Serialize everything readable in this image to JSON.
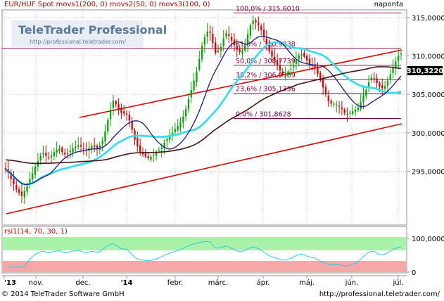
{
  "header": {
    "symbol": "EUR/HUF Spot",
    "indicators": [
      "movs1(200, 0)",
      "movs2(50, 0)",
      "movs3(100, 0)"
    ],
    "period": "naponta"
  },
  "watermark": {
    "brand": "TeleTrader Professional",
    "url": "http://professional.teletrader.com/"
  },
  "footer": {
    "copyright": "© 2014 TeleTrader Software GmbH",
    "url": "http://professional.teletrader.com/"
  },
  "colors": {
    "price_up": "#00aa00",
    "price_down": "#dd0000",
    "ma200": "#4a1010",
    "ma50": "#1a1a80",
    "ma100": "#33e0f0",
    "trend": "#dd0000",
    "rsi_line": "#22ccee"
  },
  "chart_data": [
    {
      "type": "candlestick",
      "title": "EUR/HUF Spot",
      "ylim": [
        288,
        316
      ],
      "y_ticks": [
        295,
        300,
        305,
        310,
        315
      ],
      "y_tick_labels": [
        "295,0000",
        "300,0000",
        "305,0000",
        "310,0000",
        "315,0000"
      ],
      "x_labels": [
        "'13",
        "nov.",
        "dec.",
        "'14",
        "febr.",
        "márc.",
        "ápr.",
        "máj.",
        "jún.",
        "júl."
      ],
      "last_price": "310,3220",
      "fibonacci": [
        {
          "label": "100,0% / 315,6010",
          "value": 315.601
        },
        {
          "label": "61,8% / 310,9838",
          "value": 310.9838
        },
        {
          "label": "50,0% / 308,7739",
          "value": 308.7739
        },
        {
          "label": "38,2% / 306,9389",
          "value": 306.9389
        },
        {
          "label": "23,6% / 305,1356",
          "value": 305.1356
        },
        {
          "label": "0,0% / 301,8628",
          "value": 301.8628
        }
      ],
      "close": [
        295.2,
        294.8,
        294.0,
        293.3,
        292.6,
        292.2,
        291.8,
        292.4,
        293.1,
        294.0,
        294.7,
        295.6,
        296.3,
        297.0,
        297.4,
        297.0,
        296.7,
        297.1,
        297.5,
        297.8,
        298.0,
        297.5,
        297.2,
        297.3,
        297.7,
        298.0,
        298.2,
        298.4,
        298.2,
        297.9,
        297.8,
        298.0,
        298.3,
        298.2,
        298.0,
        298.4,
        299.0,
        300.2,
        301.7,
        303.0,
        304.2,
        303.7,
        303.1,
        302.6,
        302.5,
        302.4,
        301.6,
        300.4,
        299.1,
        298.2,
        297.5,
        297.2,
        296.9,
        296.7,
        296.9,
        297.1,
        297.4,
        297.7,
        298.1,
        298.7,
        299.2,
        299.6,
        300.0,
        300.5,
        300.9,
        301.4,
        302.1,
        303.1,
        304.4,
        305.6,
        306.8,
        308.0,
        309.6,
        311.3,
        312.4,
        313.2,
        313.0,
        311.7,
        310.4,
        310.6,
        311.2,
        312.3,
        313.0,
        312.6,
        312.0,
        311.4,
        310.8,
        310.5,
        310.7,
        311.6,
        312.8,
        314.0,
        314.6,
        314.4,
        314.0,
        313.4,
        312.5,
        311.6,
        310.6,
        309.9,
        309.5,
        308.8,
        308.1,
        307.6,
        307.6,
        308.0,
        308.3,
        308.8,
        309.5,
        310.1,
        310.2,
        309.9,
        309.4,
        309.0,
        308.7,
        308.5,
        307.7,
        306.8,
        305.9,
        305.0,
        304.1,
        303.8,
        303.8,
        303.7,
        303.5,
        303.1,
        302.6,
        302.4,
        302.6,
        302.8,
        303.0,
        303.3,
        304.0,
        304.9,
        305.6,
        306.6,
        307.2,
        307.1,
        306.5,
        306.0,
        305.8,
        306.1,
        306.8,
        307.6,
        308.5,
        309.3,
        310.0,
        310.3
      ]
    },
    {
      "type": "line",
      "title": "rsi1(14, 70, 30, 1)",
      "ylim": [
        0,
        100
      ],
      "y_ticks": [
        0,
        100
      ],
      "y_tick_labels": [
        "0",
        "100,0000"
      ],
      "bands": {
        "overbought": 70,
        "oversold": 30
      }
    }
  ]
}
